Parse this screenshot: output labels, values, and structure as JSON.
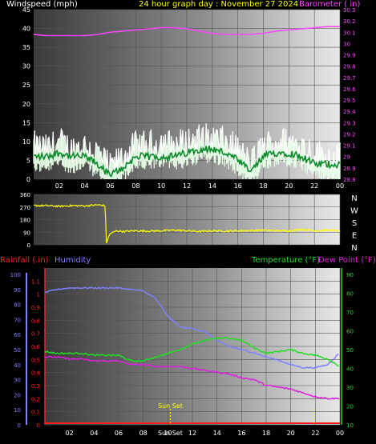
{
  "header": {
    "windspeed_label": "Windspeed (mph)",
    "title": "24 hour graph day : November 27 2024",
    "barometer_label": "Barometer ( in)"
  },
  "mid": {
    "compass": [
      "N",
      "W",
      "S",
      "E",
      "N"
    ]
  },
  "lower_header": {
    "rainfall_label": "Rainfall (.in)",
    "humidity_label": "Humidity",
    "temperature_label": "Temperature (°F)",
    "dewpoint_label": "Dew Point (°F)"
  },
  "colors": {
    "windspeed": "#ffffff",
    "wind_gust": "#2ecc40",
    "wind_avg_fill": "#e8ffe8",
    "barometer": "#ff44ff",
    "direction": "#ffff00",
    "rainfall": "#ff2020",
    "humidity": "#8080ff",
    "temperature": "#22dd22",
    "dewpoint": "#dd22dd",
    "title": "#ffff00",
    "sunset": "#ffff00"
  },
  "chart_data": [
    {
      "type": "line",
      "title": "24 hour graph day : November 27 2024",
      "x_ticks": [
        "02",
        "04",
        "06",
        "08",
        "10",
        "12",
        "14",
        "16",
        "18",
        "20",
        "22",
        "00"
      ],
      "xlim_hours": [
        0,
        24
      ],
      "left_axis": {
        "label": "Windspeed (mph)",
        "ylim": [
          0,
          45
        ],
        "ticks": [
          0,
          5,
          10,
          15,
          20,
          25,
          30,
          35,
          40,
          45
        ]
      },
      "right_axis": {
        "label": "Barometer ( in)",
        "ylim": [
          28.8,
          30.3
        ],
        "ticks": [
          "28.8",
          "28.9",
          "29",
          "29.1",
          "29.2",
          "29.3",
          "29.4",
          "29.5",
          "29.6",
          "29.7",
          "29.8",
          "29.9",
          "30",
          "30.1",
          "30.2",
          "30.3"
        ]
      },
      "series": [
        {
          "name": "Windspeed (mph)",
          "axis": "left",
          "hours": [
            0,
            1,
            2,
            3,
            4,
            5,
            6,
            7,
            8,
            9,
            10,
            11,
            12,
            13,
            14,
            15,
            16,
            17,
            18,
            19,
            20,
            21,
            22,
            23,
            24
          ],
          "values": [
            9,
            8,
            10,
            8,
            9,
            7,
            3,
            6,
            9,
            9,
            10,
            9,
            10,
            11,
            11,
            10,
            8,
            4,
            9,
            10,
            10,
            9,
            7,
            6,
            6
          ]
        },
        {
          "name": "Gust (mph)",
          "axis": "left",
          "hours": [
            0,
            1,
            2,
            3,
            4,
            5,
            6,
            7,
            8,
            9,
            10,
            11,
            12,
            13,
            14,
            15,
            16,
            17,
            18,
            19,
            20,
            21,
            22,
            23,
            24
          ],
          "values": [
            6,
            6,
            7,
            6,
            6,
            4,
            1,
            3,
            6,
            6,
            6,
            6,
            7,
            8,
            8,
            7,
            5,
            2,
            6,
            7,
            7,
            6,
            4,
            4,
            4
          ]
        },
        {
          "name": "Barometer ( in)",
          "axis": "right",
          "hours": [
            0,
            1,
            2,
            3,
            4,
            5,
            6,
            7,
            8,
            9,
            10,
            11,
            12,
            13,
            14,
            15,
            16,
            17,
            18,
            19,
            20,
            21,
            22,
            23,
            24
          ],
          "values": [
            30.08,
            30.07,
            30.07,
            30.07,
            30.07,
            30.08,
            30.1,
            30.11,
            30.12,
            30.13,
            30.14,
            30.14,
            30.13,
            30.11,
            30.09,
            30.08,
            30.08,
            30.08,
            30.09,
            30.11,
            30.12,
            30.13,
            30.14,
            30.15,
            30.15
          ]
        }
      ]
    },
    {
      "type": "line",
      "left_axis": {
        "ylim": [
          0,
          360
        ],
        "ticks": [
          0,
          90,
          180,
          270,
          360
        ]
      },
      "right_labels": [
        "N",
        "W",
        "S",
        "E",
        "N"
      ],
      "series": [
        {
          "name": "Wind direction",
          "hours": [
            0,
            1,
            2,
            3,
            4,
            5,
            5.6,
            5.7,
            6,
            6.5,
            7,
            8,
            9,
            10,
            11,
            12,
            13,
            14,
            15,
            16,
            17,
            18,
            19,
            20,
            21,
            22,
            23,
            24
          ],
          "values": [
            280,
            280,
            275,
            280,
            278,
            285,
            280,
            20,
            80,
            100,
            95,
            100,
            98,
            100,
            105,
            100,
            95,
            100,
            98,
            100,
            102,
            105,
            100,
            100,
            110,
            100,
            105,
            100
          ]
        }
      ]
    },
    {
      "type": "line",
      "x_ticks": [
        "02",
        "04",
        "06",
        "08",
        "10",
        "12",
        "14",
        "16",
        "18",
        "20",
        "22",
        "00"
      ],
      "left_axes": {
        "rainfall": {
          "label": "Rainfall (.in)",
          "ylim": [
            0,
            1.2
          ],
          "ticks": [
            "0",
            "0.1",
            "0.2",
            "0.3",
            "0.4",
            "0.5",
            "0.6",
            "0.7",
            "0.8",
            "0.9",
            "1",
            "1.1"
          ]
        },
        "humidity": {
          "label": "Humidity",
          "ylim": [
            0,
            100
          ],
          "ticks": [
            0,
            10,
            20,
            30,
            40,
            50,
            60,
            70,
            80,
            90,
            100
          ]
        }
      },
      "right_axis": {
        "label": "Temperature (°F)",
        "ylim": [
          10,
          90
        ],
        "ticks": [
          10,
          20,
          30,
          40,
          50,
          60,
          70,
          80,
          90
        ]
      },
      "annotations": [
        {
          "text": "Sun Set",
          "hour": 10.2
        },
        {
          "text": "Sun Set",
          "hour": 21.9
        }
      ],
      "series": [
        {
          "name": "Rainfall (.in)",
          "axis": "rainfall",
          "hours": [
            0,
            24
          ],
          "values": [
            0,
            0
          ]
        },
        {
          "name": "Humidity",
          "axis": "humidity",
          "hours": [
            0,
            1,
            2,
            3,
            4,
            5,
            6,
            7,
            8,
            9,
            10,
            11,
            12,
            13,
            14,
            15,
            16,
            17,
            18,
            19,
            20,
            21,
            22,
            23,
            24
          ],
          "values": [
            88,
            90,
            91,
            91,
            91,
            91,
            91,
            90,
            89,
            84,
            72,
            65,
            64,
            62,
            56,
            52,
            50,
            48,
            45,
            43,
            40,
            38,
            38,
            40,
            48
          ]
        },
        {
          "name": "Temperature (°F)",
          "axis": "right",
          "hours": [
            0,
            1,
            2,
            3,
            4,
            5,
            6,
            7,
            8,
            9,
            10,
            11,
            12,
            13,
            14,
            15,
            16,
            17,
            18,
            19,
            20,
            21,
            22,
            23,
            24
          ],
          "values": [
            49,
            48,
            48,
            48,
            47,
            47,
            47,
            44,
            44,
            46,
            48,
            50,
            53,
            55,
            56,
            56,
            55,
            51,
            48,
            49,
            50,
            48,
            47,
            45,
            41
          ]
        },
        {
          "name": "Dew Point (°F)",
          "axis": "right",
          "hours": [
            0,
            1,
            2,
            3,
            4,
            5,
            6,
            7,
            8,
            9,
            10,
            11,
            12,
            13,
            14,
            15,
            16,
            17,
            18,
            19,
            20,
            21,
            22,
            23,
            24
          ],
          "values": [
            46,
            46,
            45,
            45,
            44,
            44,
            44,
            42,
            42,
            41,
            41,
            41,
            40,
            39,
            38,
            37,
            35,
            34,
            31,
            30,
            29,
            27,
            25,
            24,
            24
          ]
        }
      ]
    }
  ]
}
